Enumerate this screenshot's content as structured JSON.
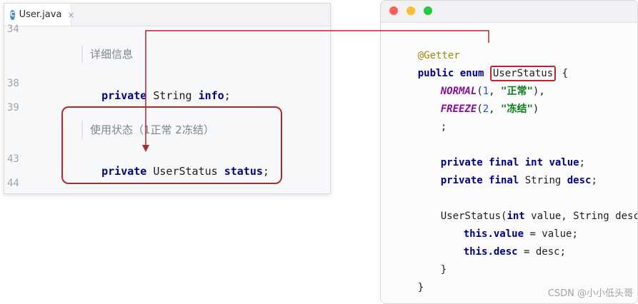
{
  "ide": {
    "tab": {
      "icon": "C",
      "label": "User.java",
      "close": "×"
    },
    "lines": [
      {
        "num": "34",
        "code": ""
      },
      {
        "num": "38",
        "kw": "private",
        "type": "String",
        "field": "info",
        "end": ";"
      },
      {
        "num": "39",
        "code": ""
      },
      {
        "num": "43",
        "kw": "private",
        "type": "UserStatus",
        "field": "status",
        "end": ";"
      },
      {
        "num": "44",
        "code": ""
      }
    ],
    "docs": {
      "info": "详细信息",
      "status": "使用状态（1正常 2冻结）"
    }
  },
  "mac": {
    "code": {
      "annotation": "@Getter",
      "decl_kw": "public enum",
      "enum_name": "UserStatus",
      "open": " {",
      "normal": {
        "name": "NORMAL",
        "num": "1",
        "str": "\"正常\""
      },
      "freeze": {
        "name": "FREEZE",
        "num": "2",
        "str": "\"冻结\""
      },
      "semi": ";",
      "value_kw": "private final int",
      "value_name": "value",
      "desc_kw": "private final",
      "desc_type": " String ",
      "desc_name": "desc",
      "ctor": "UserStatus(",
      "ctor_kw": "int",
      "ctor_rest": " value, String desc) {",
      "this1_kw": "this",
      "this1_field": ".value",
      "this1_rest": " = value;",
      "this2_kw": "this",
      "this2_field": ".desc",
      "this2_rest": " = desc;",
      "inner_close": "}",
      "outer_close": "}"
    }
  },
  "watermark": "CSDN @小小低头哥",
  "colors": {
    "highlight": "#b2282c",
    "keyword": "#000080",
    "enum_const": "#871094",
    "string": "#067d17"
  }
}
